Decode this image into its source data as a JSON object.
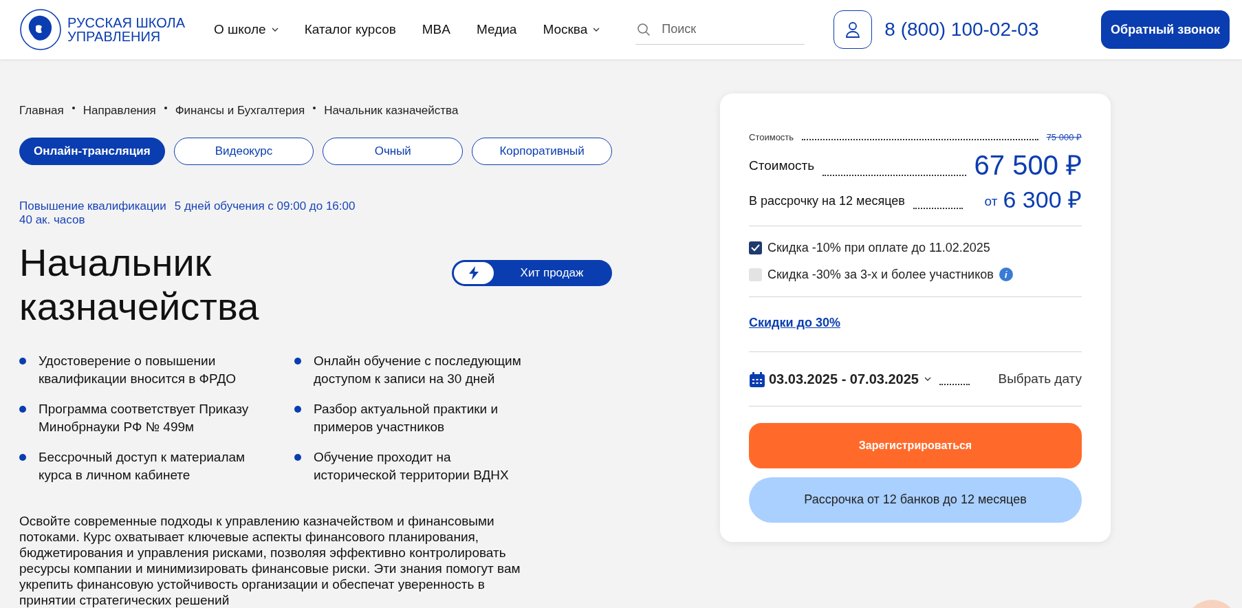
{
  "header": {
    "logo_lines": [
      "РУССКАЯ ШКОЛА",
      "УПРАВЛЕНИЯ"
    ],
    "nav": [
      {
        "label": "О школе",
        "dropdown": true
      },
      {
        "label": "Каталог курсов",
        "dropdown": false
      },
      {
        "label": "MBA",
        "dropdown": false
      },
      {
        "label": "Медиа",
        "dropdown": false
      },
      {
        "label": "Москва",
        "dropdown": true
      }
    ],
    "search": {
      "placeholder": "Поиск"
    },
    "phone": "8 (800) 100-02-03",
    "callback_button": "Обратный звонок"
  },
  "breadcrumbs": [
    "Главная",
    "Направления",
    "Финансы и Бухгалтерия",
    "Начальник казначейства"
  ],
  "format_tabs": [
    {
      "label": "Онлайн-трансляция",
      "selected": true
    },
    {
      "label": "Видеокурс",
      "selected": false
    },
    {
      "label": "Очный",
      "selected": false
    },
    {
      "label": "Корпоративный",
      "selected": false
    }
  ],
  "meta": [
    "Повышение квалификации",
    "5 дней обучения с 09:00 до 16:00",
    "40 ак. часов"
  ],
  "title": "Начальник казначейства",
  "badge": "Хит продаж",
  "features": [
    "Удостоверение о повышении квалификации вносится в ФРДО",
    "Онлайн обучение с последующим доступом к записи на 30 дней",
    "Программа соответствует Приказу Минобрнауки РФ № 499м",
    "Разбор актуальной практики и примеров участников",
    "Бессрочный доступ к материалам курса в личном кабинете",
    "Обучение проходит на исторической территории ВДНХ"
  ],
  "description": "Освойте современные подходы к управлению казначейством и финансовыми потоками. Курс охватывает ключевые аспекты финансового планирования, бюджетирования и управления рисками, позволяя эффективно контролировать ресурсы компании и минимизировать финансовые риски. Эти знания помогут вам укрепить финансовую устойчивость организации и обеспечат уверенность в принятии стратегических решений",
  "price_card": {
    "old_price": {
      "label": "Стоимость",
      "value": "75 000 ₽"
    },
    "price": {
      "label": "Стоимость",
      "value": "67 500 ₽"
    },
    "installment": {
      "label": "В рассрочку на 12 месяцев",
      "prefix": "от",
      "value": "6 300 ₽"
    },
    "discounts": [
      {
        "label": "Скидка -10% при оплате до 11.02.2025",
        "checked": true,
        "info": false
      },
      {
        "label": "Скидка -30% за 3-х и более участников",
        "checked": false,
        "info": true
      }
    ],
    "discount_link": "Скидки до 30%",
    "date": {
      "range": "03.03.2025 - 07.03.2025",
      "action": "Выбрать дату"
    },
    "register_button": "Зарегистрироваться",
    "installment_button": "Рассрочка от 12 банков до 12 месяцев"
  }
}
